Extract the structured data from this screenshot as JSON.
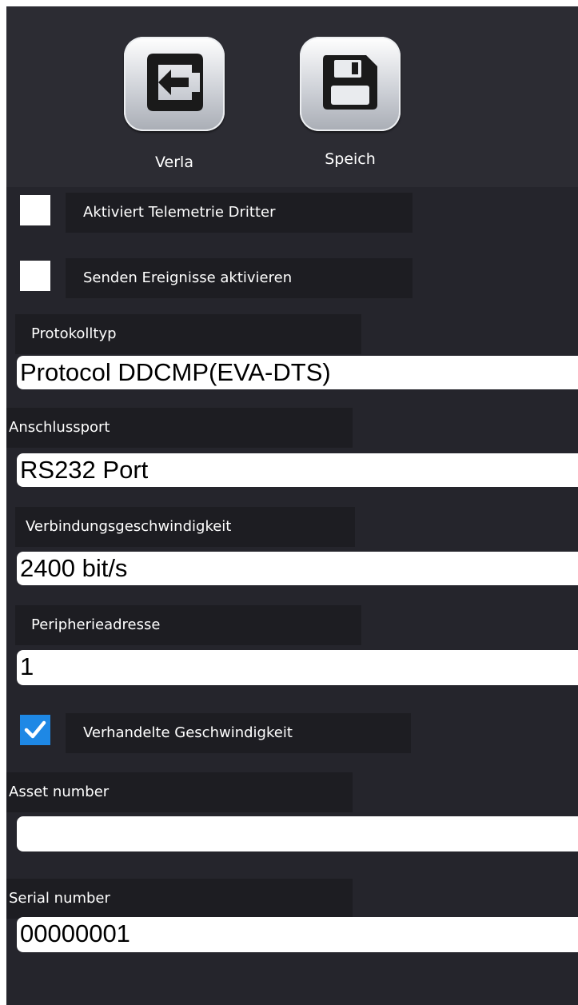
{
  "toolbar": {
    "leave_label": "Verla",
    "save_label": "Speich",
    "leave_icon": "exit-arrow-icon",
    "save_icon": "floppy-disk-icon"
  },
  "options": {
    "telemetry": {
      "label": "Aktiviert Telemetrie Dritter",
      "checked": false
    },
    "events": {
      "label": "Senden Ereignisse aktivieren",
      "checked": false
    },
    "negotiated_speed": {
      "label": "Verhandelte Geschwindigkeit",
      "checked": true
    }
  },
  "fields": {
    "protocol": {
      "label": "Protokolltyp",
      "value": "Protocol DDCMP(EVA-DTS)"
    },
    "port": {
      "label": "Anschlussport",
      "value": "RS232 Port"
    },
    "speed": {
      "label": "Verbindungsgeschwindigkeit",
      "value": "2400 bit/s"
    },
    "peripheral_address": {
      "label": "Peripherieadresse",
      "value": "1"
    },
    "asset_number": {
      "label": "Asset number",
      "value": ""
    },
    "serial_number": {
      "label": "Serial number",
      "value": "00000001"
    }
  },
  "colors": {
    "panel": "#25252c",
    "toolbar": "#2c2c33",
    "label_bg": "#1d1d22",
    "checkbox_checked": "#1e88e5"
  }
}
